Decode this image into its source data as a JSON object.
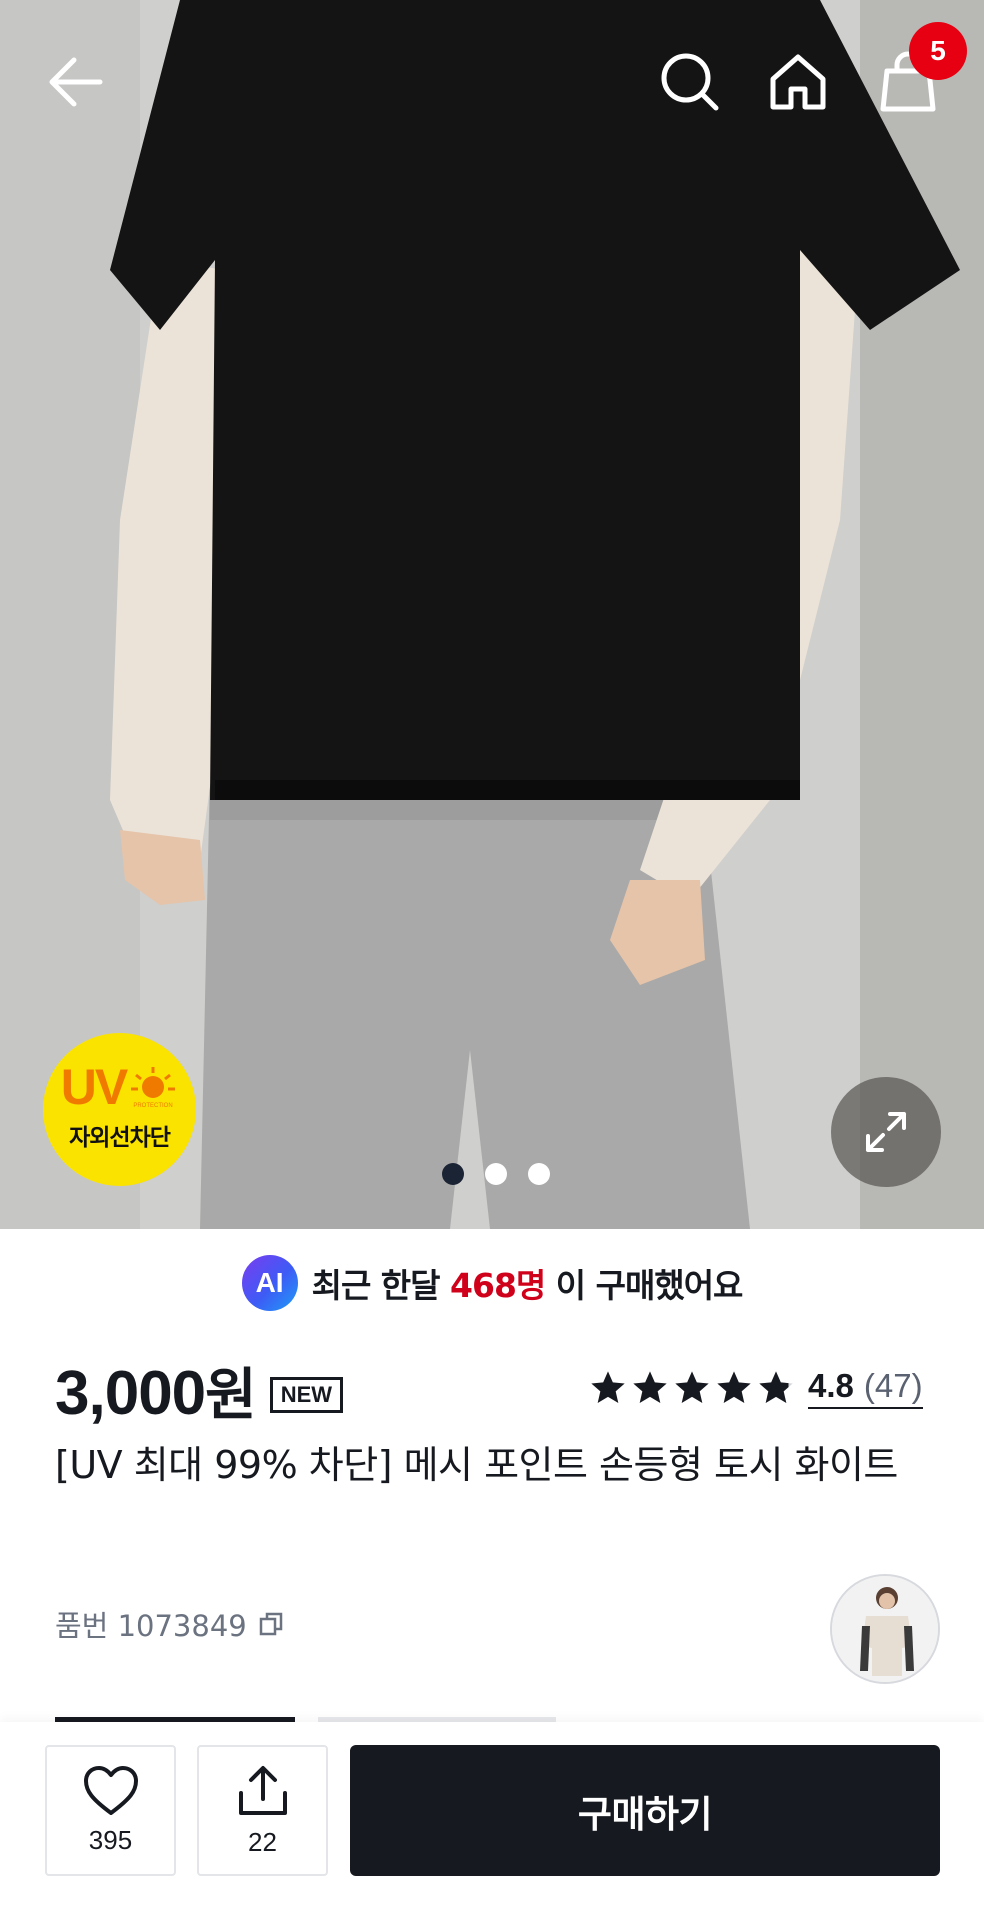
{
  "header": {
    "back_icon": "arrow-left-icon",
    "search_icon": "search-icon",
    "home_icon": "home-icon",
    "cart_icon": "shopping-bag-icon",
    "cart_count": "5"
  },
  "gallery": {
    "uv_badge": {
      "uv": "UV",
      "protection": "PROTECTION",
      "label": "자외선차단"
    },
    "expand_icon": "expand-icon",
    "pages_total": 3,
    "page_active": 1
  },
  "ai_banner": {
    "logo": "AI",
    "prefix": "최근 한달",
    "highlight": "468명",
    "suffix": "이 구매했어요",
    "highlight_color": "#d0021b"
  },
  "product": {
    "price": "3,000",
    "price_unit": "원",
    "new_tag": "NEW",
    "rating": "4.8",
    "review_count": "(47)",
    "stars": 4.8,
    "title": "[UV 최대 99% 차단] 메시 포인트 손등형 토시 화이트",
    "sku_label": "품번 1073849",
    "copy_icon": "copy-icon"
  },
  "bottom_bar": {
    "like_icon": "heart-icon",
    "like_count": "395",
    "share_icon": "share-icon",
    "share_count": "22",
    "buy_label": "구매하기"
  },
  "colors": {
    "primary_dark": "#16191f",
    "badge_red": "#e60012",
    "uv_yellow": "#fbe300",
    "uv_orange": "#f07a00"
  }
}
